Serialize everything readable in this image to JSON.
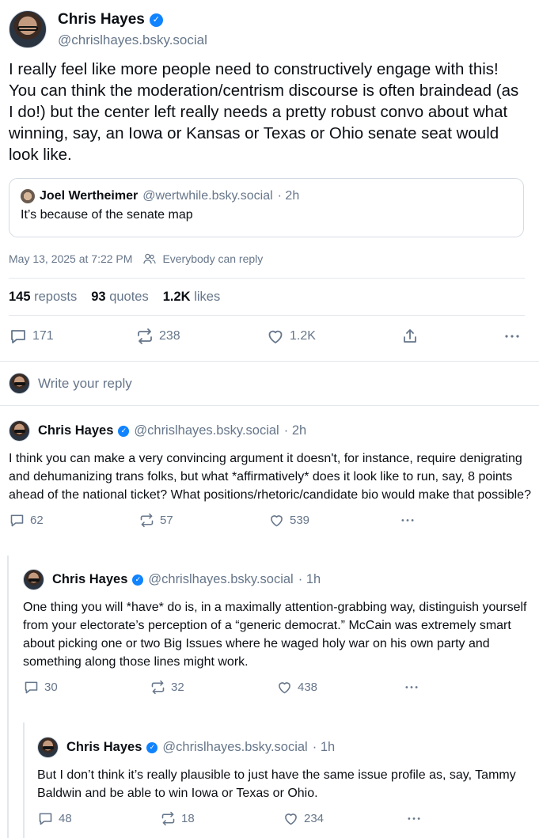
{
  "post": {
    "author_name": "Chris Hayes",
    "author_handle": "@chrislhayes.bsky.social",
    "text": "I really feel like more people need to constructively engage with this! You can think the moderation/centrism discourse is often braindead (as I do!) but the center left really needs a pretty robust convo about what winning, say, an Iowa or Kansas or Texas or Ohio senate seat would look like.",
    "quote": {
      "author_name": "Joel Wertheimer",
      "author_handle": "@wertwhile.bsky.social",
      "time": "· 2h",
      "text": "It’s because of the senate map"
    },
    "timestamp": "May 13, 2025 at 7:22 PM",
    "reply_permission": "Everybody can reply",
    "stats": {
      "reposts_count": "145",
      "reposts_label": "reposts",
      "quotes_count": "93",
      "quotes_label": "quotes",
      "likes_count": "1.2K",
      "likes_label": "likes"
    },
    "actions": {
      "replies": "171",
      "reposts": "238",
      "likes": "1.2K"
    }
  },
  "reply_box": {
    "placeholder": "Write your reply"
  },
  "replies": [
    {
      "author_name": "Chris Hayes",
      "author_handle": "@chrislhayes.bsky.social",
      "time": "· 2h",
      "text": "I think you can make a very convincing argument it doesn't, for instance, require denigrating and dehumanizing trans folks, but what *affirmatively* does it look like to run, say, 8 points ahead of the national ticket? What positions/rhetoric/candidate bio would make that possible?",
      "replies": "62",
      "reposts": "57",
      "likes": "539"
    },
    {
      "author_name": "Chris Hayes",
      "author_handle": "@chrislhayes.bsky.social",
      "time": "· 1h",
      "text": "One thing you will *have* do is, in a maximally attention-grabbing way, distinguish yourself from your electorate’s perception of a “generic democrat.” McCain was extremely smart about picking one or two Big Issues where he waged holy war on his own party and something along those lines might work.",
      "replies": "30",
      "reposts": "32",
      "likes": "438"
    },
    {
      "author_name": "Chris Hayes",
      "author_handle": "@chrislhayes.bsky.social",
      "time": "· 1h",
      "text": "But I don’t think it’s really plausible to just have the same issue profile as, say, Tammy Baldwin and be able to win Iowa or Texas or Ohio.",
      "replies": "48",
      "reposts": "18",
      "likes": "234"
    }
  ]
}
